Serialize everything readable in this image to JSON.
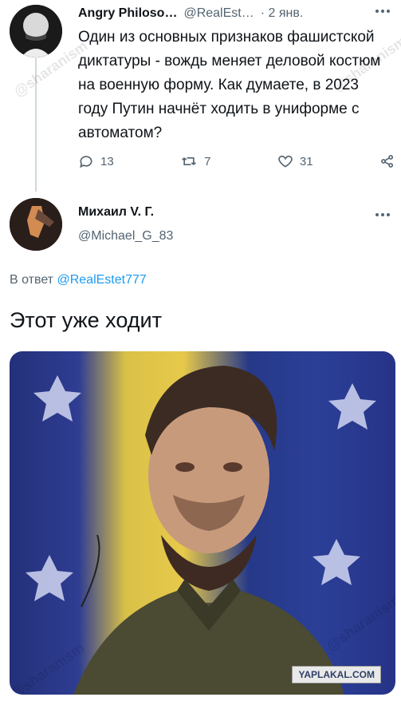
{
  "tweet1": {
    "author_name": "Angry Philoso…",
    "handle": "@RealEst…",
    "date": "· 2 янв.",
    "text": "Один из основных признаков фашистской диктатуры - вождь меняет деловой костюм на военную форму. Как думаете, в 2023 году Путин начнёт ходить в униформе с автоматом?",
    "replies": "13",
    "retweets": "7",
    "likes": "31",
    "icons": {
      "reply": "reply-icon",
      "retweet": "retweet-icon",
      "like": "heart-icon",
      "share": "share-icon",
      "more": "more-icon"
    }
  },
  "tweet2": {
    "author_name": "Михаил V. Г.",
    "handle": "@Michael_G_83",
    "reply_prefix": "В ответ",
    "reply_to": "@RealEstet777",
    "text": "Этот уже ходит"
  },
  "watermark": {
    "text": "@sharanism"
  },
  "badge": {
    "text": "YAPLAKAL.COM"
  },
  "colors": {
    "link": "#1d9bf0",
    "muted": "#536471"
  }
}
